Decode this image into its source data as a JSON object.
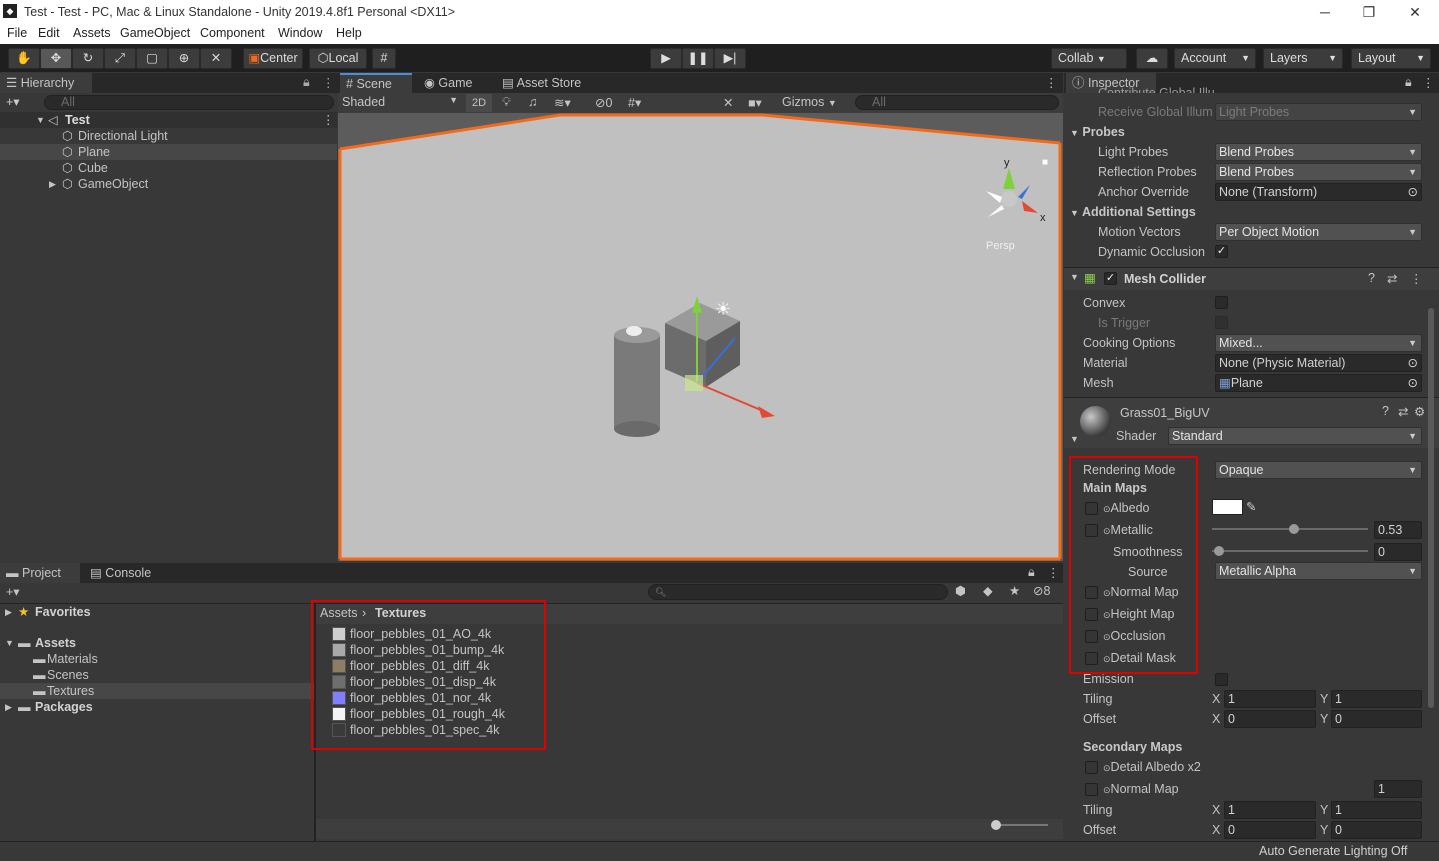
{
  "window": {
    "title": "Test - Test - PC, Mac & Linux Standalone - Unity 2019.4.8f1 Personal <DX11>",
    "minimize": "─",
    "maximize": "❐",
    "close": "✕"
  },
  "menu": [
    "File",
    "Edit",
    "Assets",
    "GameObject",
    "Component",
    "Window",
    "Help"
  ],
  "toolbar": {
    "center": "Center",
    "local": "Local",
    "collab": "Collab",
    "account": "Account",
    "layers": "Layers",
    "layout": "Layout"
  },
  "hierarchy": {
    "tab": "Hierarchy",
    "search_placeholder": "All",
    "scene": "Test",
    "items": [
      "Directional Light",
      "Plane",
      "Cube",
      "GameObject"
    ]
  },
  "scene": {
    "tabs": [
      "Scene",
      "Game",
      "Asset Store"
    ],
    "shading": "Shaded",
    "mode_2d": "2D",
    "hidden_count": "0",
    "gizmos": "Gizmos",
    "search_placeholder": "All",
    "persp": "Persp",
    "axis_y": "y",
    "axis_x": "x"
  },
  "project": {
    "tabs": [
      "Project",
      "Console"
    ],
    "hidden_count": "8",
    "favorites": "Favorites",
    "assets": "Assets",
    "folders": [
      "Materials",
      "Scenes",
      "Textures"
    ],
    "packages": "Packages",
    "breadcrumb": [
      "Assets",
      "Textures"
    ],
    "files": [
      {
        "name": "floor_pebbles_01_AO_4k",
        "color": "#cfcfcf"
      },
      {
        "name": "floor_pebbles_01_bump_4k",
        "color": "#a9a9a9"
      },
      {
        "name": "floor_pebbles_01_diff_4k",
        "color": "#8c7e66"
      },
      {
        "name": "floor_pebbles_01_disp_4k",
        "color": "#6e6e6e"
      },
      {
        "name": "floor_pebbles_01_nor_4k",
        "color": "#7f7fff"
      },
      {
        "name": "floor_pebbles_01_rough_4k",
        "color": "#f4f4f4"
      },
      {
        "name": "floor_pebbles_01_spec_4k",
        "color": "#3a3a3a"
      }
    ]
  },
  "inspector": {
    "tab": "Inspector",
    "contribute_gi": "Contribute Global Illu",
    "receive_gi": "Receive Global Illum",
    "receive_gi_value": "Light Probes",
    "probes": "Probes",
    "light_probes": "Light Probes",
    "light_probes_value": "Blend Probes",
    "reflection_probes": "Reflection Probes",
    "reflection_probes_value": "Blend Probes",
    "anchor_override": "Anchor Override",
    "anchor_override_value": "None (Transform)",
    "additional_settings": "Additional Settings",
    "motion_vectors": "Motion Vectors",
    "motion_vectors_value": "Per Object Motion",
    "dynamic_occlusion": "Dynamic Occlusion",
    "mesh_collider": "Mesh Collider",
    "convex": "Convex",
    "is_trigger": "Is Trigger",
    "cooking_options": "Cooking Options",
    "cooking_options_value": "Mixed...",
    "material": "Material",
    "material_value": "None (Physic Material)",
    "mesh": "Mesh",
    "mesh_value": "Plane",
    "material_name": "Grass01_BigUV",
    "shader_label": "Shader",
    "shader_value": "Standard",
    "rendering_mode": "Rendering Mode",
    "rendering_mode_value": "Opaque",
    "main_maps": "Main Maps",
    "albedo": "Albedo",
    "metallic": "Metallic",
    "metallic_value": "0.53",
    "smoothness": "Smoothness",
    "smoothness_value": "0",
    "source": "Source",
    "source_value": "Metallic Alpha",
    "normal_map": "Normal Map",
    "height_map": "Height Map",
    "occlusion": "Occlusion",
    "detail_mask": "Detail Mask",
    "emission": "Emission",
    "tiling": "Tiling",
    "offset": "Offset",
    "x": "X",
    "y": "Y",
    "tiling_x": "1",
    "tiling_y": "1",
    "offset_x": "0",
    "offset_y": "0",
    "secondary_maps": "Secondary Maps",
    "detail_albedo": "Detail Albedo x2",
    "sec_normal_map": "Normal Map",
    "sec_normal_value": "1",
    "sec_tiling_x": "1",
    "sec_tiling_y": "1",
    "sec_offset_x": "0",
    "sec_offset_y": "0"
  },
  "status": {
    "text": "Auto Generate Lighting Off"
  },
  "colors": {
    "accent": "#e00000",
    "selection_orange": "#f26b1d",
    "panel_bg": "#383838"
  }
}
